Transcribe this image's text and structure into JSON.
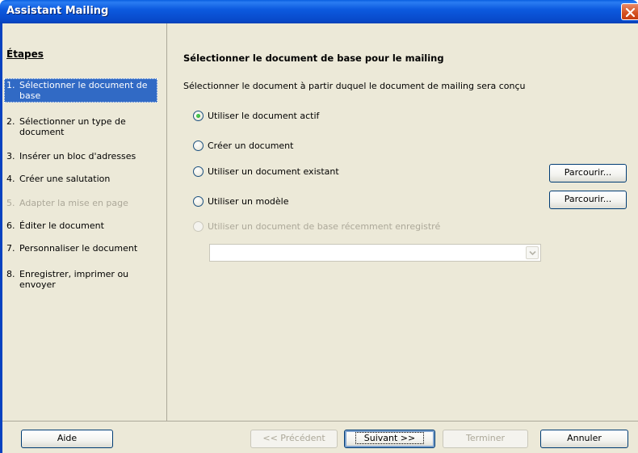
{
  "window": {
    "title": "Assistant Mailing"
  },
  "steps": {
    "heading": "Étapes",
    "items": [
      {
        "num": "1.",
        "label": "Sélectionner le document de base",
        "state": "selected"
      },
      {
        "num": "2.",
        "label": "Sélectionner un type de document",
        "state": "normal"
      },
      {
        "num": "3.",
        "label": "Insérer un bloc d'adresses",
        "state": "normal"
      },
      {
        "num": "4.",
        "label": "Créer une salutation",
        "state": "normal"
      },
      {
        "num": "5.",
        "label": "Adapter la mise en page",
        "state": "disabled"
      },
      {
        "num": "6.",
        "label": "Éditer le document",
        "state": "normal"
      },
      {
        "num": "7.",
        "label": "Personnaliser le document",
        "state": "normal"
      },
      {
        "num": "8.",
        "label": "Enregistrer, imprimer ou envoyer",
        "state": "normal"
      }
    ]
  },
  "main": {
    "heading": "Sélectionner le document de base pour le mailing",
    "description": "Sélectionner le document à partir duquel le document de mailing sera conçu",
    "options": [
      {
        "label": "Utiliser le document actif",
        "checked": true,
        "enabled": true
      },
      {
        "label": "Créer un document",
        "checked": false,
        "enabled": true
      },
      {
        "label": "Utiliser un document existant",
        "checked": false,
        "enabled": true
      },
      {
        "label": "Utiliser un modèle",
        "checked": false,
        "enabled": true
      },
      {
        "label": "Utiliser un document de base récemment enregistré",
        "checked": false,
        "enabled": false
      }
    ],
    "browse_label_1": "Parcourir...",
    "browse_label_2": "Parcourir...",
    "recent_combo_value": ""
  },
  "buttons": {
    "help": "Aide",
    "previous": "<< Précédent",
    "next": "Suivant >>",
    "finish": "Terminer",
    "cancel": "Annuler"
  },
  "colors": {
    "titlebar": "#0c5adf",
    "selection": "#316ac5",
    "dialog_bg": "#ece9d8",
    "disabled_text": "#aca899"
  }
}
